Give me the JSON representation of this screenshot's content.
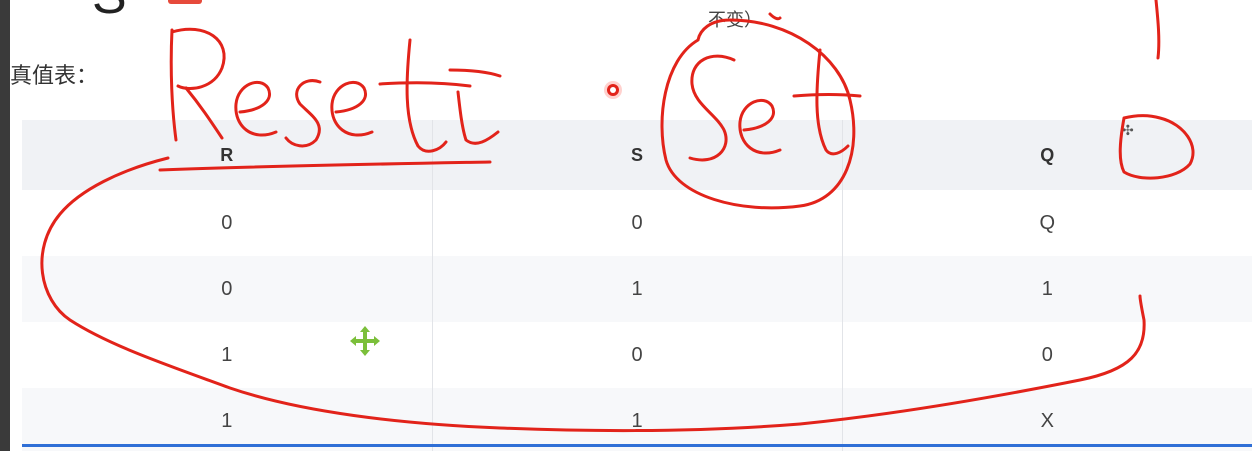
{
  "header": {
    "letter": "S",
    "note": "不变）"
  },
  "truth_table": {
    "label": "真值表：",
    "columns": [
      "R",
      "S",
      "Q"
    ],
    "rows": [
      [
        "0",
        "0",
        "Q"
      ],
      [
        "0",
        "1",
        "1"
      ],
      [
        "1",
        "0",
        "0"
      ],
      [
        "1",
        "1",
        "X"
      ]
    ]
  },
  "annotations": {
    "reset_word": "Reset",
    "set_word": "Set",
    "ink_color": "#e2231a",
    "cursor_color": "#7bbf3a"
  },
  "icons": {
    "move_cursor": "move-arrows-icon",
    "record_dot": "record-dot-icon"
  },
  "colors": {
    "header_row": "#f0f2f5",
    "accent_blue": "#2f6fd6"
  }
}
